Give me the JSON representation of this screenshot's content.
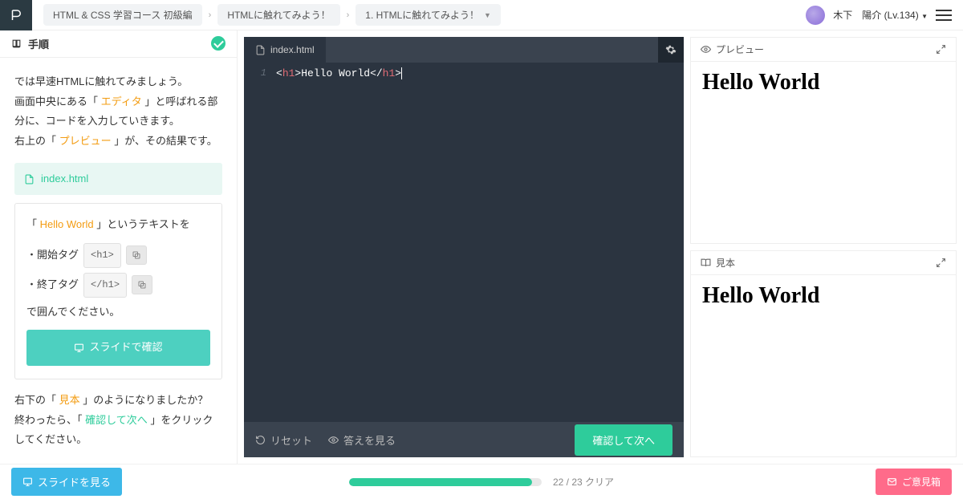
{
  "breadcrumb": {
    "course": "HTML & CSS 学習コース 初級編",
    "chapter": "HTMLに触れてみよう！",
    "lesson": "1. HTMLに触れてみよう！"
  },
  "user": {
    "name": "木下　陽介 (Lv.134)"
  },
  "left": {
    "title": "手順",
    "intro1_a": "では早速HTMLに触れてみましょう。",
    "intro2_a": "画面中央にある「 ",
    "intro2_hl": "エディタ",
    "intro2_b": " 」と呼ばれる部分に、コードを入力していきます。",
    "intro3_a": "右上の「 ",
    "intro3_hl": "プレビュー",
    "intro3_b": " 」が、その結果です。",
    "file": "index.html",
    "step1_a": "「 ",
    "step1_hl": "Hello World",
    "step1_b": " 」というテキストを",
    "start_tag_label": "・開始タグ",
    "start_tag_code": "<h1>",
    "end_tag_label": "・終了タグ",
    "end_tag_code": "</h1>",
    "step_tail": "で囲んでください。",
    "slide_confirm": "スライドで確認",
    "outro1_a": "右下の「 ",
    "outro1_hl": "見本",
    "outro1_b": " 」のようになりましたか？",
    "outro2_a": "終わったら、「 ",
    "outro2_hl": "確認して次へ",
    "outro2_b": " 」をクリックしてください。"
  },
  "editor": {
    "tab": "index.html",
    "line_no": "1",
    "code_open": "<",
    "code_tag1": "h1",
    "code_close1": ">",
    "code_text": "Hello World",
    "code_open2": "</",
    "code_tag2": "h1",
    "code_close2": ">",
    "reset": "リセット",
    "answer": "答えを見る",
    "confirm": "確認して次へ"
  },
  "preview": {
    "title": "プレビュー",
    "content": "Hello World"
  },
  "sample": {
    "title": "見本",
    "content": "Hello World"
  },
  "footer": {
    "slide_view": "スライドを見る",
    "progress_text": "22 / 23 クリア",
    "progress_pct": 95,
    "feedback": "ご意見箱"
  }
}
